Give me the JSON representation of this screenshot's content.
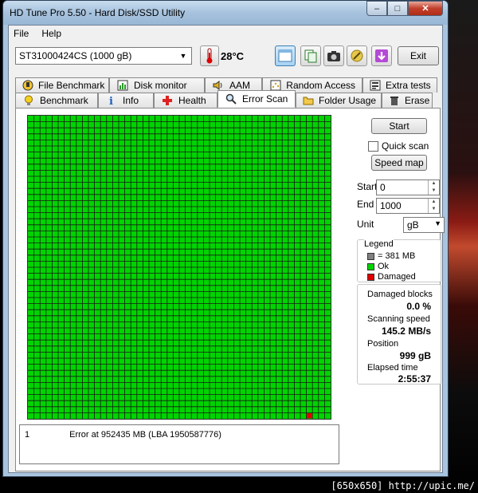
{
  "window": {
    "title": "HD Tune Pro 5.50 - Hard Disk/SSD Utility",
    "minimize": "–",
    "maximize": "□",
    "close": "✕"
  },
  "menu": {
    "file": "File",
    "help": "Help"
  },
  "toolbar": {
    "drive": "ST31000424CS (1000 gB)",
    "temperature": "28°C",
    "exit_label": "Exit"
  },
  "tabs_top": [
    "File Benchmark",
    "Disk monitor",
    "AAM",
    "Random Access",
    "Extra tests"
  ],
  "tabs_bottom": [
    "Benchmark",
    "Info",
    "Health",
    "Error Scan",
    "Folder Usage",
    "Erase"
  ],
  "active_tab": "Error Scan",
  "scan": {
    "start_label": "Start",
    "quick_scan_label": "Quick scan",
    "speed_map_label": "Speed map",
    "start_field_label": "Start",
    "start_value": "0",
    "end_field_label": "End",
    "end_value": "1000",
    "unit_label": "Unit",
    "unit_value": "gB"
  },
  "legend": {
    "title": "Legend",
    "block_size": "= 381 MB",
    "ok": "Ok",
    "damaged": "Damaged",
    "colors": {
      "block": "#808080",
      "ok": "#00d400",
      "damaged": "#e00000"
    }
  },
  "stats": {
    "damaged_blocks_label": "Damaged blocks",
    "damaged_blocks_value": "0.0 %",
    "scanning_speed_label": "Scanning speed",
    "scanning_speed_value": "145.2 MB/s",
    "position_label": "Position",
    "position_value": "999 gB",
    "elapsed_label": "Elapsed time",
    "elapsed_value": "2:55:37"
  },
  "errors": [
    {
      "index": "1",
      "message": "Error at 952435 MB (LBA 1950587776)"
    }
  ],
  "watermark": "[650x650] http://upic.me/"
}
